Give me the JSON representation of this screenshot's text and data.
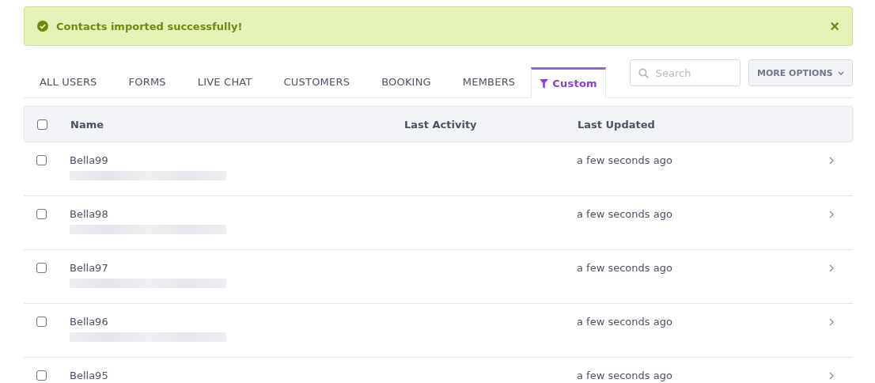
{
  "alert": {
    "message": "Contacts imported successfully!",
    "close": "×"
  },
  "tabs": [
    {
      "label": "ALL USERS",
      "selected": false,
      "kind": "plain"
    },
    {
      "label": "FORMS",
      "selected": false,
      "kind": "plain"
    },
    {
      "label": "LIVE CHAT",
      "selected": false,
      "kind": "plain"
    },
    {
      "label": "CUSTOMERS",
      "selected": false,
      "kind": "plain"
    },
    {
      "label": "BOOKING",
      "selected": false,
      "kind": "plain"
    },
    {
      "label": "MEMBERS",
      "selected": false,
      "kind": "plain"
    },
    {
      "label": "Custom",
      "selected": true,
      "kind": "filter"
    }
  ],
  "search": {
    "placeholder": "Search"
  },
  "more_options": "MORE OPTIONS",
  "table": {
    "select_all_checked": false,
    "columns": [
      "Name",
      "Last Activity",
      "Last Updated"
    ],
    "rows": [
      {
        "name": "Bella99",
        "checked": false,
        "last_updated": "a few seconds ago"
      },
      {
        "name": "Bella98",
        "checked": false,
        "last_updated": "a few seconds ago"
      },
      {
        "name": "Bella97",
        "checked": false,
        "last_updated": "a few seconds ago"
      },
      {
        "name": "Bella96",
        "checked": false,
        "last_updated": "a few seconds ago"
      },
      {
        "name": "Bella95",
        "checked": false,
        "last_updated": "a few seconds ago"
      }
    ]
  }
}
